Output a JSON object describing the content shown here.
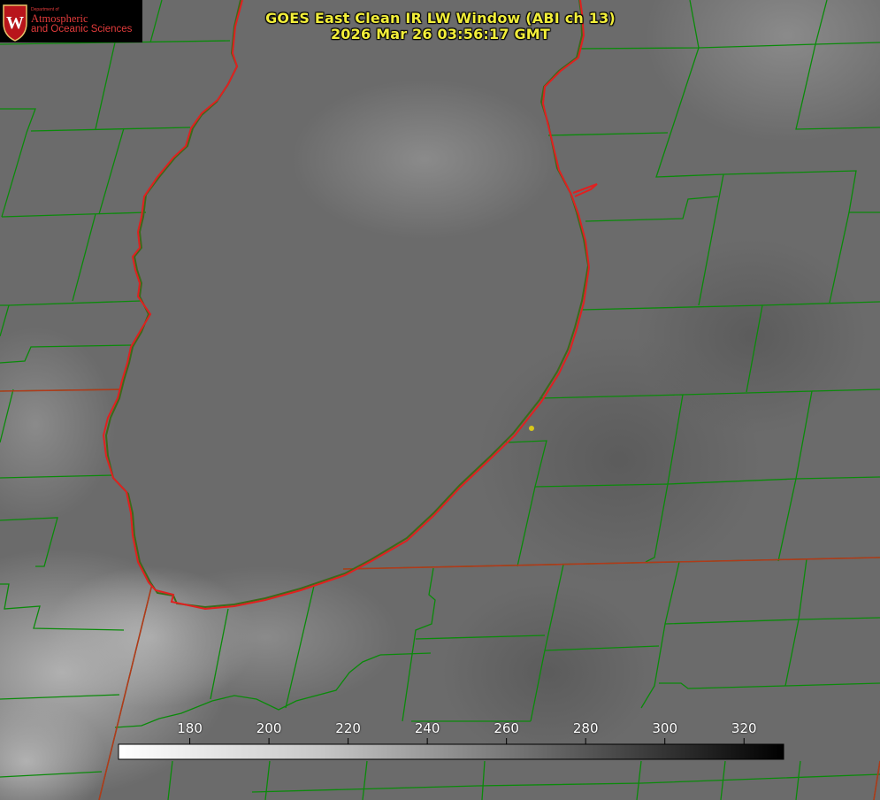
{
  "title": {
    "line1": "GOES East Clean IR LW Window (ABI ch 13)",
    "line2": "2026 Mar 26 03:56:17 GMT"
  },
  "logo": {
    "dept": "Department of",
    "line1": "Atmospheric",
    "line2": "and Oceanic Sciences",
    "emblem": "W"
  },
  "colorbar": {
    "ticks": [
      "180",
      "200",
      "220",
      "240",
      "260",
      "280",
      "300",
      "320"
    ],
    "min": 162,
    "max": 330,
    "start_color": "#ffffff",
    "end_color": "#000000"
  },
  "colors": {
    "title": "#f2ee3a",
    "county_lines": "#0a8a0a",
    "coast_line": "#e02020",
    "marker": "#d8c81a",
    "logo_text": "#e23b3b"
  }
}
